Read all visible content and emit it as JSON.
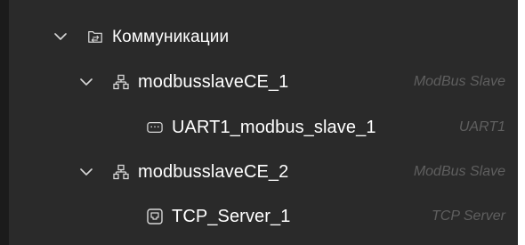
{
  "tree": {
    "root": {
      "label": "Коммуникации",
      "icon": "communications-folder-icon"
    },
    "nodes": [
      {
        "label": "modbusslaveCE_1",
        "meta": "ModBus Slave",
        "icon": "network-tree-icon",
        "children": [
          {
            "label": "UART1_modbus_slave_1",
            "meta": "UART1",
            "icon": "serial-port-icon"
          }
        ]
      },
      {
        "label": "modbusslaveCE_2",
        "meta": "ModBus Slave",
        "icon": "network-tree-icon",
        "children": [
          {
            "label": "TCP_Server_1",
            "meta": "TCP Server",
            "icon": "ethernet-port-icon"
          }
        ]
      }
    ]
  },
  "colors": {
    "background": "#2a2a2a",
    "text": "#ffffff",
    "meta_text": "#5f5f5f",
    "icon": "#d8d8d8"
  }
}
